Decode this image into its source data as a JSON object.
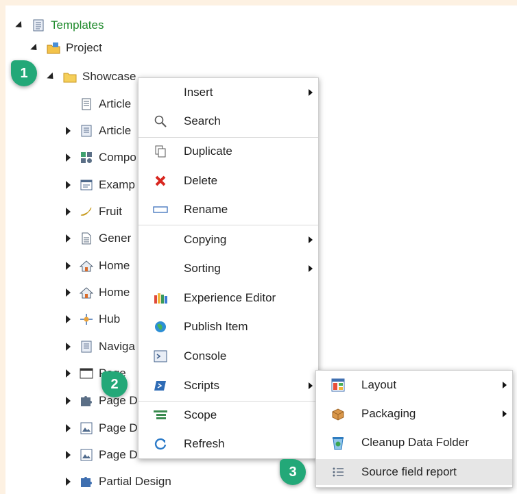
{
  "tree": [
    {
      "label": "Templates",
      "state": "expanded",
      "icon": "template-icon",
      "color": "#1f8a2c"
    },
    {
      "label": "Project",
      "state": "expanded",
      "icon": "project-folder-icon"
    },
    {
      "label": "Showcase",
      "state": "expanded",
      "icon": "folder-icon"
    },
    {
      "label": "Article",
      "state": "none",
      "icon": "document-icon"
    },
    {
      "label": "Article",
      "state": "collapsed",
      "icon": "template-icon"
    },
    {
      "label": "Compo",
      "state": "collapsed",
      "icon": "component-icon"
    },
    {
      "label": "Examp",
      "state": "collapsed",
      "icon": "window-icon"
    },
    {
      "label": "Fruit",
      "state": "collapsed",
      "icon": "banana-icon"
    },
    {
      "label": "Gener",
      "state": "collapsed",
      "icon": "page-icon"
    },
    {
      "label": "Home",
      "state": "collapsed",
      "icon": "home-icon"
    },
    {
      "label": "Home",
      "state": "collapsed",
      "icon": "home-icon"
    },
    {
      "label": "Hub",
      "state": "collapsed",
      "icon": "hub-icon"
    },
    {
      "label": "Naviga",
      "state": "collapsed",
      "icon": "template-icon"
    },
    {
      "label": "Page",
      "state": "collapsed",
      "icon": "window-icon"
    },
    {
      "label": "Page D",
      "state": "collapsed",
      "icon": "puzzle-icon"
    },
    {
      "label": "Page D",
      "state": "collapsed",
      "icon": "image-icon"
    },
    {
      "label": "Page D",
      "state": "collapsed",
      "icon": "image-icon"
    },
    {
      "label": "Partial Design",
      "state": "collapsed",
      "icon": "puzzle-icon"
    }
  ],
  "context_menu": {
    "items": [
      {
        "label": "Insert",
        "submenu": true,
        "icon": ""
      },
      {
        "label": "Search",
        "submenu": false,
        "icon": "search-icon"
      },
      {
        "label": "Duplicate",
        "submenu": false,
        "icon": "duplicate-icon"
      },
      {
        "label": "Delete",
        "submenu": false,
        "icon": "delete-icon"
      },
      {
        "label": "Rename",
        "submenu": false,
        "icon": "rename-icon"
      },
      {
        "label": "Copying",
        "submenu": true,
        "icon": ""
      },
      {
        "label": "Sorting",
        "submenu": true,
        "icon": ""
      },
      {
        "label": "Experience Editor",
        "submenu": false,
        "icon": "experience-editor-icon"
      },
      {
        "label": "Publish Item",
        "submenu": false,
        "icon": "publish-icon"
      },
      {
        "label": "Console",
        "submenu": false,
        "icon": "console-icon"
      },
      {
        "label": "Scripts",
        "submenu": true,
        "icon": "powershell-icon"
      },
      {
        "label": "Scope",
        "submenu": false,
        "icon": "scope-icon"
      },
      {
        "label": "Refresh",
        "submenu": false,
        "icon": "refresh-icon"
      }
    ]
  },
  "scripts_submenu": {
    "items": [
      {
        "label": "Layout",
        "submenu": true,
        "icon": "layout-icon"
      },
      {
        "label": "Packaging",
        "submenu": true,
        "icon": "package-icon"
      },
      {
        "label": "Cleanup Data Folder",
        "submenu": false,
        "icon": "recycle-icon"
      },
      {
        "label": "Source field report",
        "submenu": false,
        "icon": "list-icon",
        "highlighted": true
      }
    ]
  },
  "callouts": [
    "1",
    "2",
    "3"
  ],
  "colors": {
    "callout": "#23a878",
    "background": "#fdf1e2",
    "highlight": "#e6e6e6",
    "tree_root_text": "#1f8a2c"
  }
}
